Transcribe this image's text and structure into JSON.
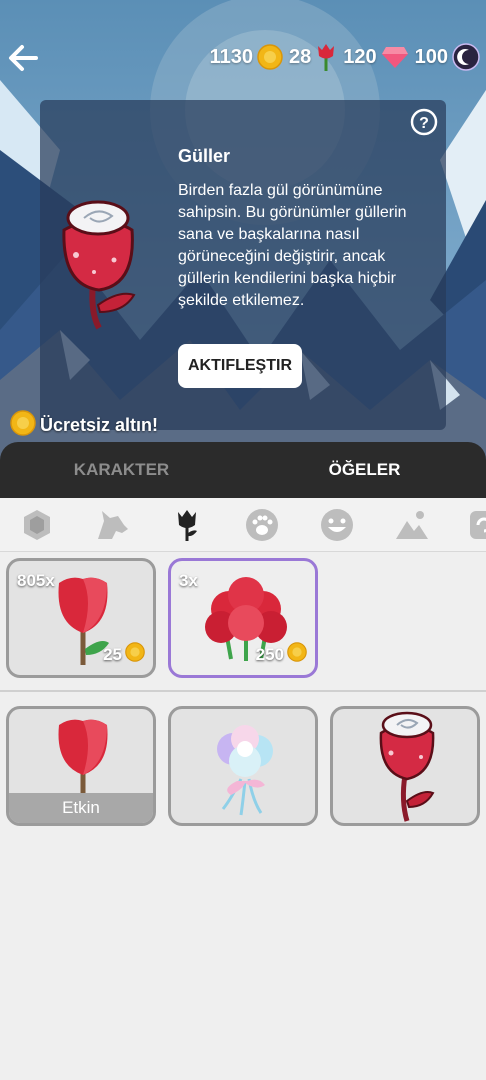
{
  "currencies": [
    {
      "value": "1130",
      "icon": "gold-coin-icon"
    },
    {
      "value": "28",
      "icon": "rose-icon"
    },
    {
      "value": "120",
      "icon": "gem-icon"
    },
    {
      "value": "100",
      "icon": "moon-token-icon"
    }
  ],
  "card": {
    "title": "Güller",
    "description": "Birden fazla gül görünümüne sahipsin. Bu görünümler güllerin sana ve başkalarına nasıl görüneceğini değiştirir, ancak güllerin kendilerini başka hiçbir şekilde etkilemez.",
    "button_label": "AKTIFLEŞTIR"
  },
  "free_gold_label": "Ücretsiz altın!",
  "tabs": [
    {
      "label": "KARAKTER",
      "active": false
    },
    {
      "label": "ÖĞELER",
      "active": true
    }
  ],
  "categories": [
    "badge-icon",
    "wolf-icon",
    "rose-icon",
    "paw-icon",
    "emoji-icon",
    "landscape-icon",
    "more-icon"
  ],
  "shop_items": [
    {
      "count": "805x",
      "price": "25",
      "name": "single-rose"
    },
    {
      "count": "3x",
      "price": "250",
      "name": "rose-bouquet",
      "selected": true
    }
  ],
  "owned_items": [
    {
      "name": "classic-rose",
      "status": "Etkin"
    },
    {
      "name": "rainbow-rose"
    },
    {
      "name": "glass-rose"
    }
  ],
  "colors": {
    "tab_bar": "#2b2b2b",
    "selected_border": "#9a78d6",
    "slot_border": "#9b9b9b",
    "gold": "#f2b616",
    "rose": "#d9283b",
    "gem": "#f2577e"
  }
}
